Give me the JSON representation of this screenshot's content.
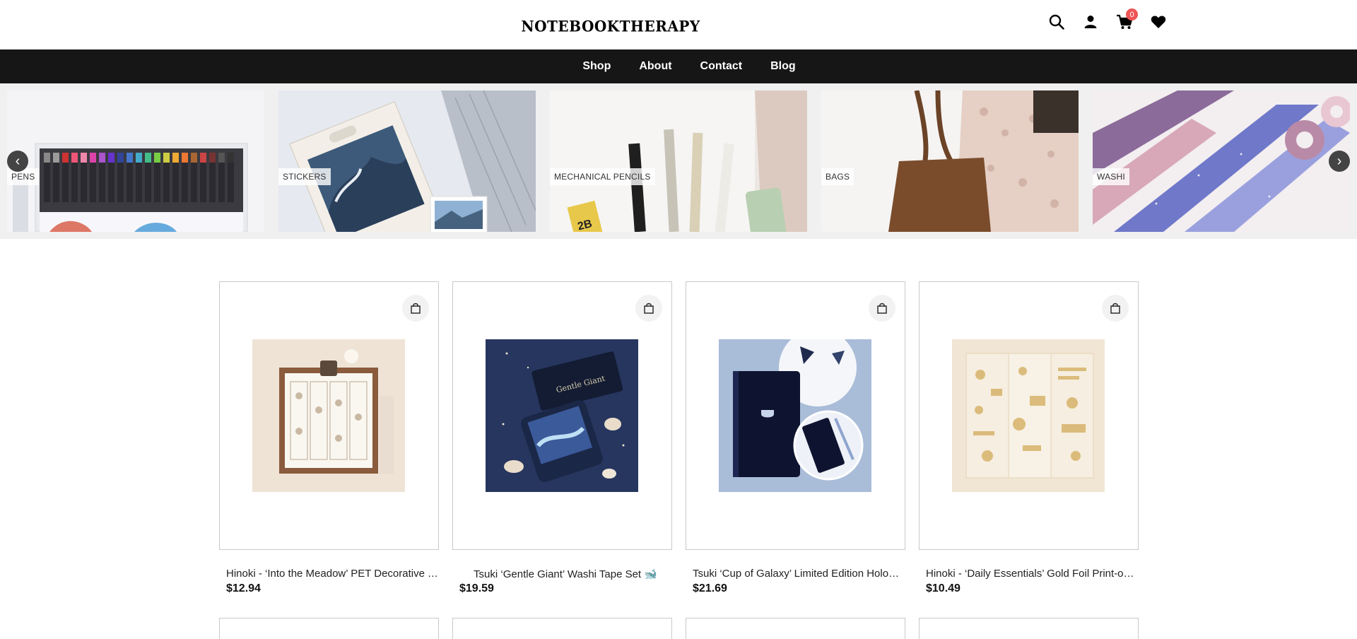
{
  "header": {
    "logo_text": "NOTEBOOKTHERAPY",
    "cart_count": "0",
    "icons": [
      "search-icon",
      "user-icon",
      "cart-icon",
      "heart-icon"
    ]
  },
  "nav": {
    "items": [
      {
        "label": "Shop"
      },
      {
        "label": "About"
      },
      {
        "label": "Contact"
      },
      {
        "label": "Blog"
      }
    ]
  },
  "categories": [
    {
      "label": "PENS"
    },
    {
      "label": "STICKERS"
    },
    {
      "label": "MECHANICAL PENCILS"
    },
    {
      "label": "BAGS"
    },
    {
      "label": "WASHI"
    }
  ],
  "carousel": {
    "prev_symbol": "‹",
    "next_symbol": "›"
  },
  "products": [
    {
      "name": "Hinoki - ‘Into the Meadow’ PET Decorative Tape",
      "price": "$12.94"
    },
    {
      "name": "Tsuki ‘Gentle Giant’ Washi Tape Set 🐋",
      "price": "$19.59"
    },
    {
      "name": "Tsuki ‘Cup of Galaxy’ Limited Edition Holographic Notebook",
      "price": "$21.69"
    },
    {
      "name": "Hinoki - ‘Daily Essentials’ Gold Foil Print-on Stickers",
      "price": "$10.49"
    }
  ],
  "colors": {
    "nav_bg": "#161616",
    "badge": "#e55555",
    "carousel_bg": "#f0f0f0"
  }
}
